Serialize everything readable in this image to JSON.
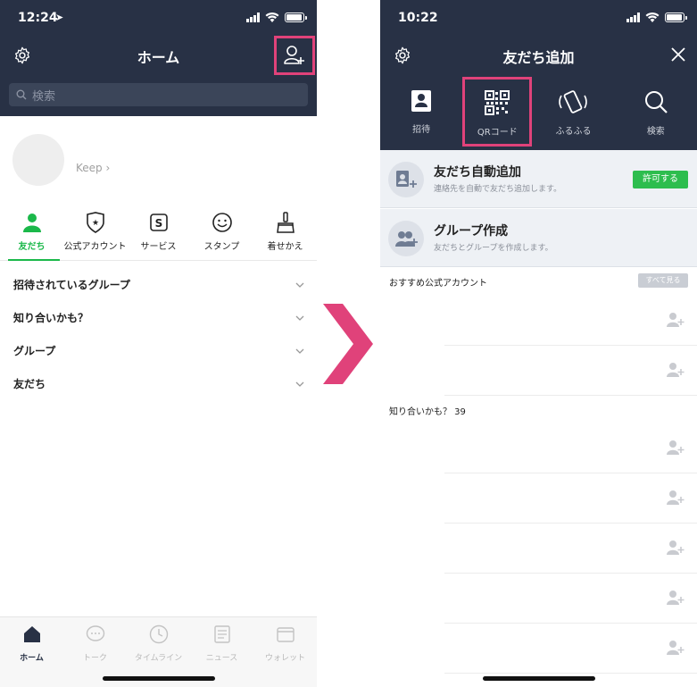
{
  "left": {
    "status_time": "12:24",
    "header_title": "ホーム",
    "search_placeholder": "検索",
    "keep_label": "Keep",
    "tabs": [
      {
        "label": "友だち"
      },
      {
        "label": "公式アカウント"
      },
      {
        "label": "サービス"
      },
      {
        "label": "スタンプ"
      },
      {
        "label": "着せかえ"
      }
    ],
    "sections": [
      {
        "label": "招待されているグループ"
      },
      {
        "label": "知り合いかも？"
      },
      {
        "label": "グループ"
      },
      {
        "label": "友だち"
      }
    ],
    "bottom_nav": [
      {
        "label": "ホーム"
      },
      {
        "label": "トーク"
      },
      {
        "label": "タイムライン"
      },
      {
        "label": "ニュース"
      },
      {
        "label": "ウォレット"
      }
    ]
  },
  "right": {
    "status_time": "10:22",
    "header_title": "友だち追加",
    "top_items": [
      {
        "label": "招待"
      },
      {
        "label": "QRコード"
      },
      {
        "label": "ふるふる"
      },
      {
        "label": "検索"
      }
    ],
    "auto_add": {
      "title": "友だち自動追加",
      "subtitle": "連絡先を自動で友だち追加します。",
      "button": "許可する"
    },
    "group_create": {
      "title": "グループ作成",
      "subtitle": "友だちとグループを作成します。"
    },
    "official_label": "おすすめ公式アカウント",
    "see_all": "すべて見る",
    "maybe_label": "知り合いかも？ 39"
  },
  "colors": {
    "header": "#283145",
    "accent_green": "#1bb84a",
    "highlight": "#e0427a",
    "button_green": "#2dbd4e"
  }
}
